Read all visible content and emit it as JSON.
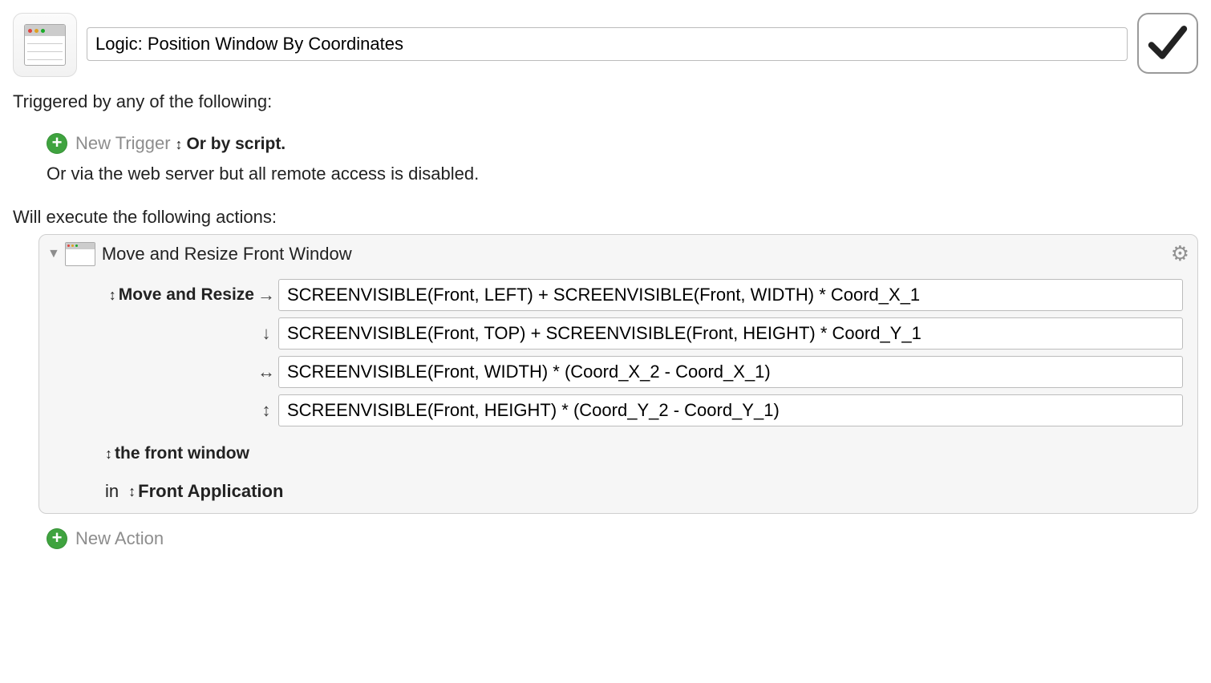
{
  "header": {
    "macro_name": "Logic: Position Window By Coordinates"
  },
  "triggers": {
    "header_text": "Triggered by any of the following:",
    "new_trigger_label": "New Trigger",
    "or_by_script_label": "Or by script.",
    "disabled_note": "Or via the web server but all remote access is disabled."
  },
  "actions_header": "Will execute the following actions:",
  "action": {
    "title": "Move and Resize Front Window",
    "operation_label": "Move and Resize",
    "expressions": {
      "x": "SCREENVISIBLE(Front, LEFT) + SCREENVISIBLE(Front, WIDTH) * Coord_X_1",
      "y": "SCREENVISIBLE(Front, TOP) + SCREENVISIBLE(Front, HEIGHT) * Coord_Y_1",
      "w": "SCREENVISIBLE(Front, WIDTH) * (Coord_X_2 - Coord_X_1)",
      "h": "SCREENVISIBLE(Front, HEIGHT) * (Coord_Y_2 - Coord_Y_1)"
    },
    "window_target": "the front window",
    "in_label": "in",
    "application_target": "Front Application"
  },
  "new_action_label": "New Action"
}
